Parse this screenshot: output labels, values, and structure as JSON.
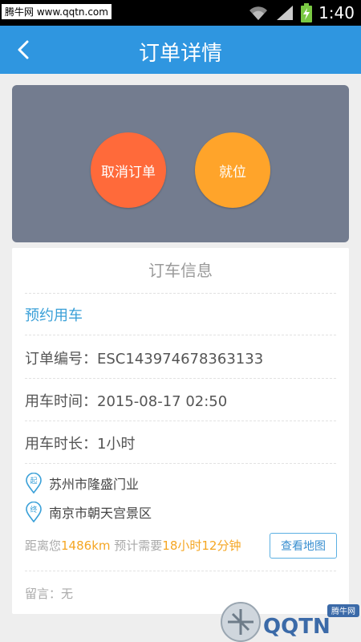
{
  "statusbar": {
    "watermark": "腾牛网 www.qqtn.com",
    "time": "1:40"
  },
  "header": {
    "title": "订单详情",
    "back_icon": "chevron-left-icon"
  },
  "actions": {
    "cancel_label": "取消订单",
    "ready_label": "就位"
  },
  "info": {
    "card_title": "订车信息",
    "order_type": "预约用车",
    "order_no": "订单编号：ESC143974678363133",
    "use_time": "用车时间：2015-08-17 02:50",
    "duration": "用车时长：1小时",
    "start_marker": "起",
    "start": "苏州市隆盛门业",
    "end_marker": "终",
    "end": "南京市朝天宫景区",
    "distance_prefix": "距离您",
    "distance": "1486km",
    "eta_prefix": " 预计需要",
    "eta": "18小时12分钟",
    "map_button": "查看地图",
    "message": "留言：无"
  },
  "watermark": {
    "logo_text": "QQTN",
    "badge": "腾牛网"
  },
  "colors": {
    "header": "#2f96e0",
    "panel": "#737c8f",
    "cancel": "#ff6a3a",
    "ready": "#ffa42a",
    "highlight": "#f5a623",
    "link": "#3aa0d8"
  }
}
